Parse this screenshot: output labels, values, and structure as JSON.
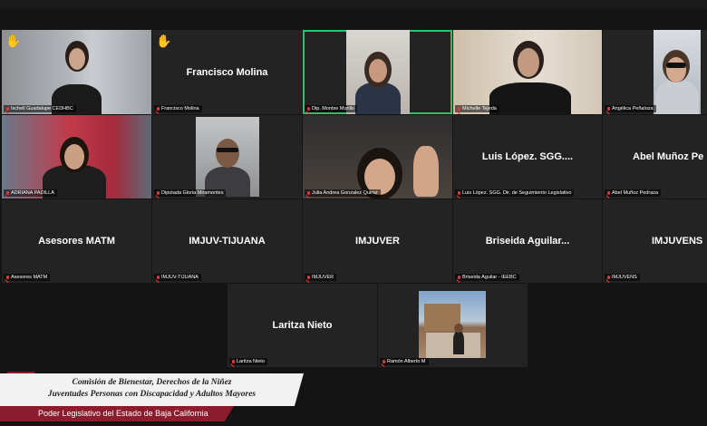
{
  "tiles": [
    {
      "label": "Ischell Guadalupe CEDHBC",
      "hand": true
    },
    {
      "label": "Francisco Molina",
      "center_name": "Francisco Molina",
      "hand": true
    },
    {
      "label": "Dip. Montse Murillo",
      "active": true
    },
    {
      "label": "Michelle Tejeda"
    },
    {
      "label": "Angélica Peñaloza"
    },
    {
      "label": "ADRIANA PADILLA"
    },
    {
      "label": "Diputada Gloria Miramontes"
    },
    {
      "label": "Julia Andrea Gonzalez Quiroz"
    },
    {
      "label": "Luis López. SGG. Dir. de Seguimiento Legislativo",
      "center_name": "Luis López. SGG...."
    },
    {
      "label": "Abel Muñoz Pedraza",
      "center_name": "Abel Muñoz Pe"
    },
    {
      "label": "Asesores MATM",
      "center_name": "Asesores MATM"
    },
    {
      "label": "IMJUV-TIJUANA",
      "center_name": "IMJUV-TIJUANA"
    },
    {
      "label": "IMJUVER",
      "center_name": "IMJUVER"
    },
    {
      "label": "Briseida Aguilar - IEEBC",
      "center_name": "Briseida Aguilar..."
    },
    {
      "label": "IMJUVENS",
      "center_name": "IMJUVENS"
    },
    {
      "label": "Laritza Nieto",
      "center_name": "Laritza Nieto"
    },
    {
      "label": "Ramón Alberto M"
    }
  ],
  "hand_icon": "✋",
  "banner": {
    "line1": "Comisión de Bienestar, Derechos de la Niñez",
    "line2": "Juventudes Personas con Discapacidad y Adultos Mayores",
    "footer": "Poder Legislativo del Estado de Baja California"
  },
  "colors": {
    "active_outline": "#29c46a",
    "mic_muted": "#e03b3b",
    "banner_red": "#8b1b2d"
  }
}
